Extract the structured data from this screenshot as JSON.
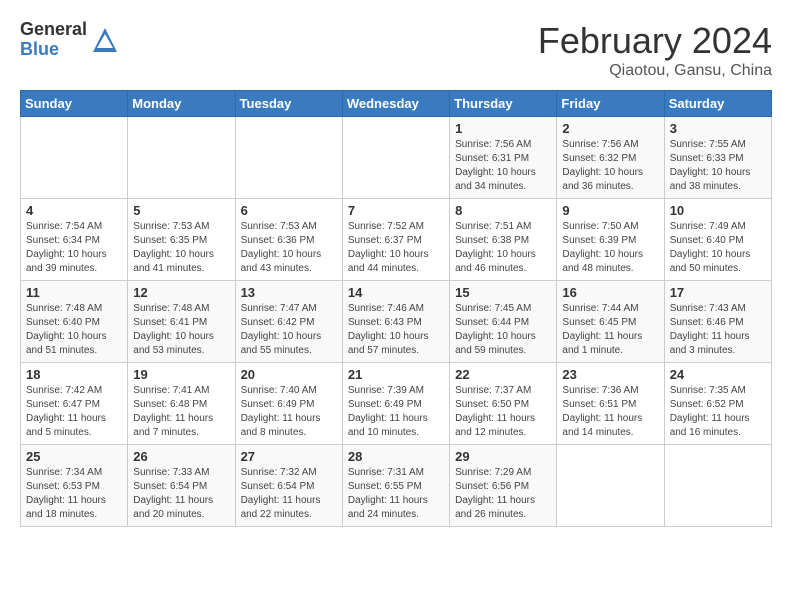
{
  "logo": {
    "general": "General",
    "blue": "Blue"
  },
  "title": "February 2024",
  "location": "Qiaotou, Gansu, China",
  "days_header": [
    "Sunday",
    "Monday",
    "Tuesday",
    "Wednesday",
    "Thursday",
    "Friday",
    "Saturday"
  ],
  "weeks": [
    [
      {
        "day": "",
        "info": ""
      },
      {
        "day": "",
        "info": ""
      },
      {
        "day": "",
        "info": ""
      },
      {
        "day": "",
        "info": ""
      },
      {
        "day": "1",
        "info": "Sunrise: 7:56 AM\nSunset: 6:31 PM\nDaylight: 10 hours\nand 34 minutes."
      },
      {
        "day": "2",
        "info": "Sunrise: 7:56 AM\nSunset: 6:32 PM\nDaylight: 10 hours\nand 36 minutes."
      },
      {
        "day": "3",
        "info": "Sunrise: 7:55 AM\nSunset: 6:33 PM\nDaylight: 10 hours\nand 38 minutes."
      }
    ],
    [
      {
        "day": "4",
        "info": "Sunrise: 7:54 AM\nSunset: 6:34 PM\nDaylight: 10 hours\nand 39 minutes."
      },
      {
        "day": "5",
        "info": "Sunrise: 7:53 AM\nSunset: 6:35 PM\nDaylight: 10 hours\nand 41 minutes."
      },
      {
        "day": "6",
        "info": "Sunrise: 7:53 AM\nSunset: 6:36 PM\nDaylight: 10 hours\nand 43 minutes."
      },
      {
        "day": "7",
        "info": "Sunrise: 7:52 AM\nSunset: 6:37 PM\nDaylight: 10 hours\nand 44 minutes."
      },
      {
        "day": "8",
        "info": "Sunrise: 7:51 AM\nSunset: 6:38 PM\nDaylight: 10 hours\nand 46 minutes."
      },
      {
        "day": "9",
        "info": "Sunrise: 7:50 AM\nSunset: 6:39 PM\nDaylight: 10 hours\nand 48 minutes."
      },
      {
        "day": "10",
        "info": "Sunrise: 7:49 AM\nSunset: 6:40 PM\nDaylight: 10 hours\nand 50 minutes."
      }
    ],
    [
      {
        "day": "11",
        "info": "Sunrise: 7:48 AM\nSunset: 6:40 PM\nDaylight: 10 hours\nand 51 minutes."
      },
      {
        "day": "12",
        "info": "Sunrise: 7:48 AM\nSunset: 6:41 PM\nDaylight: 10 hours\nand 53 minutes."
      },
      {
        "day": "13",
        "info": "Sunrise: 7:47 AM\nSunset: 6:42 PM\nDaylight: 10 hours\nand 55 minutes."
      },
      {
        "day": "14",
        "info": "Sunrise: 7:46 AM\nSunset: 6:43 PM\nDaylight: 10 hours\nand 57 minutes."
      },
      {
        "day": "15",
        "info": "Sunrise: 7:45 AM\nSunset: 6:44 PM\nDaylight: 10 hours\nand 59 minutes."
      },
      {
        "day": "16",
        "info": "Sunrise: 7:44 AM\nSunset: 6:45 PM\nDaylight: 11 hours\nand 1 minute."
      },
      {
        "day": "17",
        "info": "Sunrise: 7:43 AM\nSunset: 6:46 PM\nDaylight: 11 hours\nand 3 minutes."
      }
    ],
    [
      {
        "day": "18",
        "info": "Sunrise: 7:42 AM\nSunset: 6:47 PM\nDaylight: 11 hours\nand 5 minutes."
      },
      {
        "day": "19",
        "info": "Sunrise: 7:41 AM\nSunset: 6:48 PM\nDaylight: 11 hours\nand 7 minutes."
      },
      {
        "day": "20",
        "info": "Sunrise: 7:40 AM\nSunset: 6:49 PM\nDaylight: 11 hours\nand 8 minutes."
      },
      {
        "day": "21",
        "info": "Sunrise: 7:39 AM\nSunset: 6:49 PM\nDaylight: 11 hours\nand 10 minutes."
      },
      {
        "day": "22",
        "info": "Sunrise: 7:37 AM\nSunset: 6:50 PM\nDaylight: 11 hours\nand 12 minutes."
      },
      {
        "day": "23",
        "info": "Sunrise: 7:36 AM\nSunset: 6:51 PM\nDaylight: 11 hours\nand 14 minutes."
      },
      {
        "day": "24",
        "info": "Sunrise: 7:35 AM\nSunset: 6:52 PM\nDaylight: 11 hours\nand 16 minutes."
      }
    ],
    [
      {
        "day": "25",
        "info": "Sunrise: 7:34 AM\nSunset: 6:53 PM\nDaylight: 11 hours\nand 18 minutes."
      },
      {
        "day": "26",
        "info": "Sunrise: 7:33 AM\nSunset: 6:54 PM\nDaylight: 11 hours\nand 20 minutes."
      },
      {
        "day": "27",
        "info": "Sunrise: 7:32 AM\nSunset: 6:54 PM\nDaylight: 11 hours\nand 22 minutes."
      },
      {
        "day": "28",
        "info": "Sunrise: 7:31 AM\nSunset: 6:55 PM\nDaylight: 11 hours\nand 24 minutes."
      },
      {
        "day": "29",
        "info": "Sunrise: 7:29 AM\nSunset: 6:56 PM\nDaylight: 11 hours\nand 26 minutes."
      },
      {
        "day": "",
        "info": ""
      },
      {
        "day": "",
        "info": ""
      }
    ]
  ]
}
